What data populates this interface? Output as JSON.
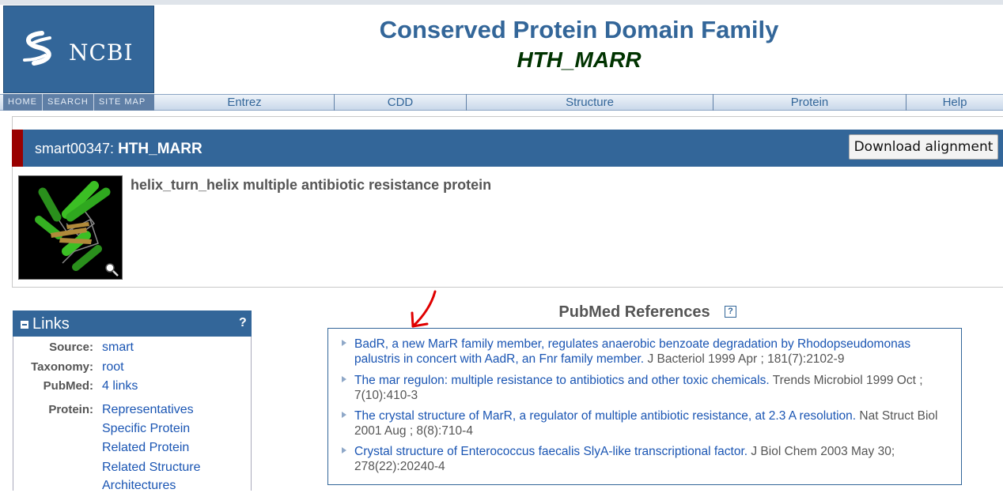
{
  "header": {
    "logo_text": "NCBI",
    "title": "Conserved Protein Domain Family",
    "subtitle": "HTH_MARR"
  },
  "nav": {
    "left": [
      "HOME",
      "SEARCH",
      "SITE MAP"
    ],
    "items": [
      "Entrez",
      "CDD",
      "Structure",
      "Protein",
      "Help"
    ]
  },
  "record": {
    "accession": "smart00347:",
    "name": "HTH_MARR",
    "download_label": "Download alignment",
    "description": "helix_turn_helix multiple antibiotic resistance protein"
  },
  "links": {
    "title": "Links",
    "help": "?",
    "source_label": "Source:",
    "source_value": "smart",
    "taxonomy_label": "Taxonomy:",
    "taxonomy_value": "root",
    "pubmed_label": "PubMed:",
    "pubmed_value": "4 links",
    "protein_label": "Protein:",
    "protein_items": [
      "Representatives",
      "Specific Protein",
      "Related Protein",
      "Related Structure",
      "Architectures"
    ]
  },
  "references": {
    "heading": "PubMed References",
    "help": "?",
    "items": [
      {
        "title_line1": "BadR, a new MarR family member, regulates anaerobic benzoate degradation by Rhodopseudomonas",
        "title_line2": "palustris in concert with AadR, an Fnr family member.",
        "citation": "J Bacteriol 1999 Apr ; 181(7):2102-9"
      },
      {
        "title": "The mar regulon: multiple resistance to antibiotics and other toxic chemicals.",
        "citation_line1": "Trends Microbiol 1999 Oct ;",
        "citation_line2": "7(10):410-3"
      },
      {
        "title": "The crystal structure of MarR, a regulator of multiple antibiotic resistance, at 2.3 A resolution.",
        "citation_line1": "Nat Struct Biol",
        "citation_line2": "2001 Aug ; 8(8):710-4"
      },
      {
        "title": "Crystal structure of Enterococcus faecalis SlyA-like transcriptional factor.",
        "citation_line1": "J Biol Chem 2003 May 30;",
        "citation_line2": "278(22):20240-4"
      }
    ]
  },
  "colors": {
    "brand_blue": "#336699",
    "link_blue": "#1a55b3",
    "flag_red": "#990000",
    "subtitle_green": "#003300",
    "annotation_arrow": "#e00000"
  },
  "icons": [
    "ncbi-helix-icon",
    "magnifier-icon",
    "collapse-minus-icon",
    "help-icon",
    "bullet-triangle-icon",
    "annotation-arrow-icon"
  ]
}
